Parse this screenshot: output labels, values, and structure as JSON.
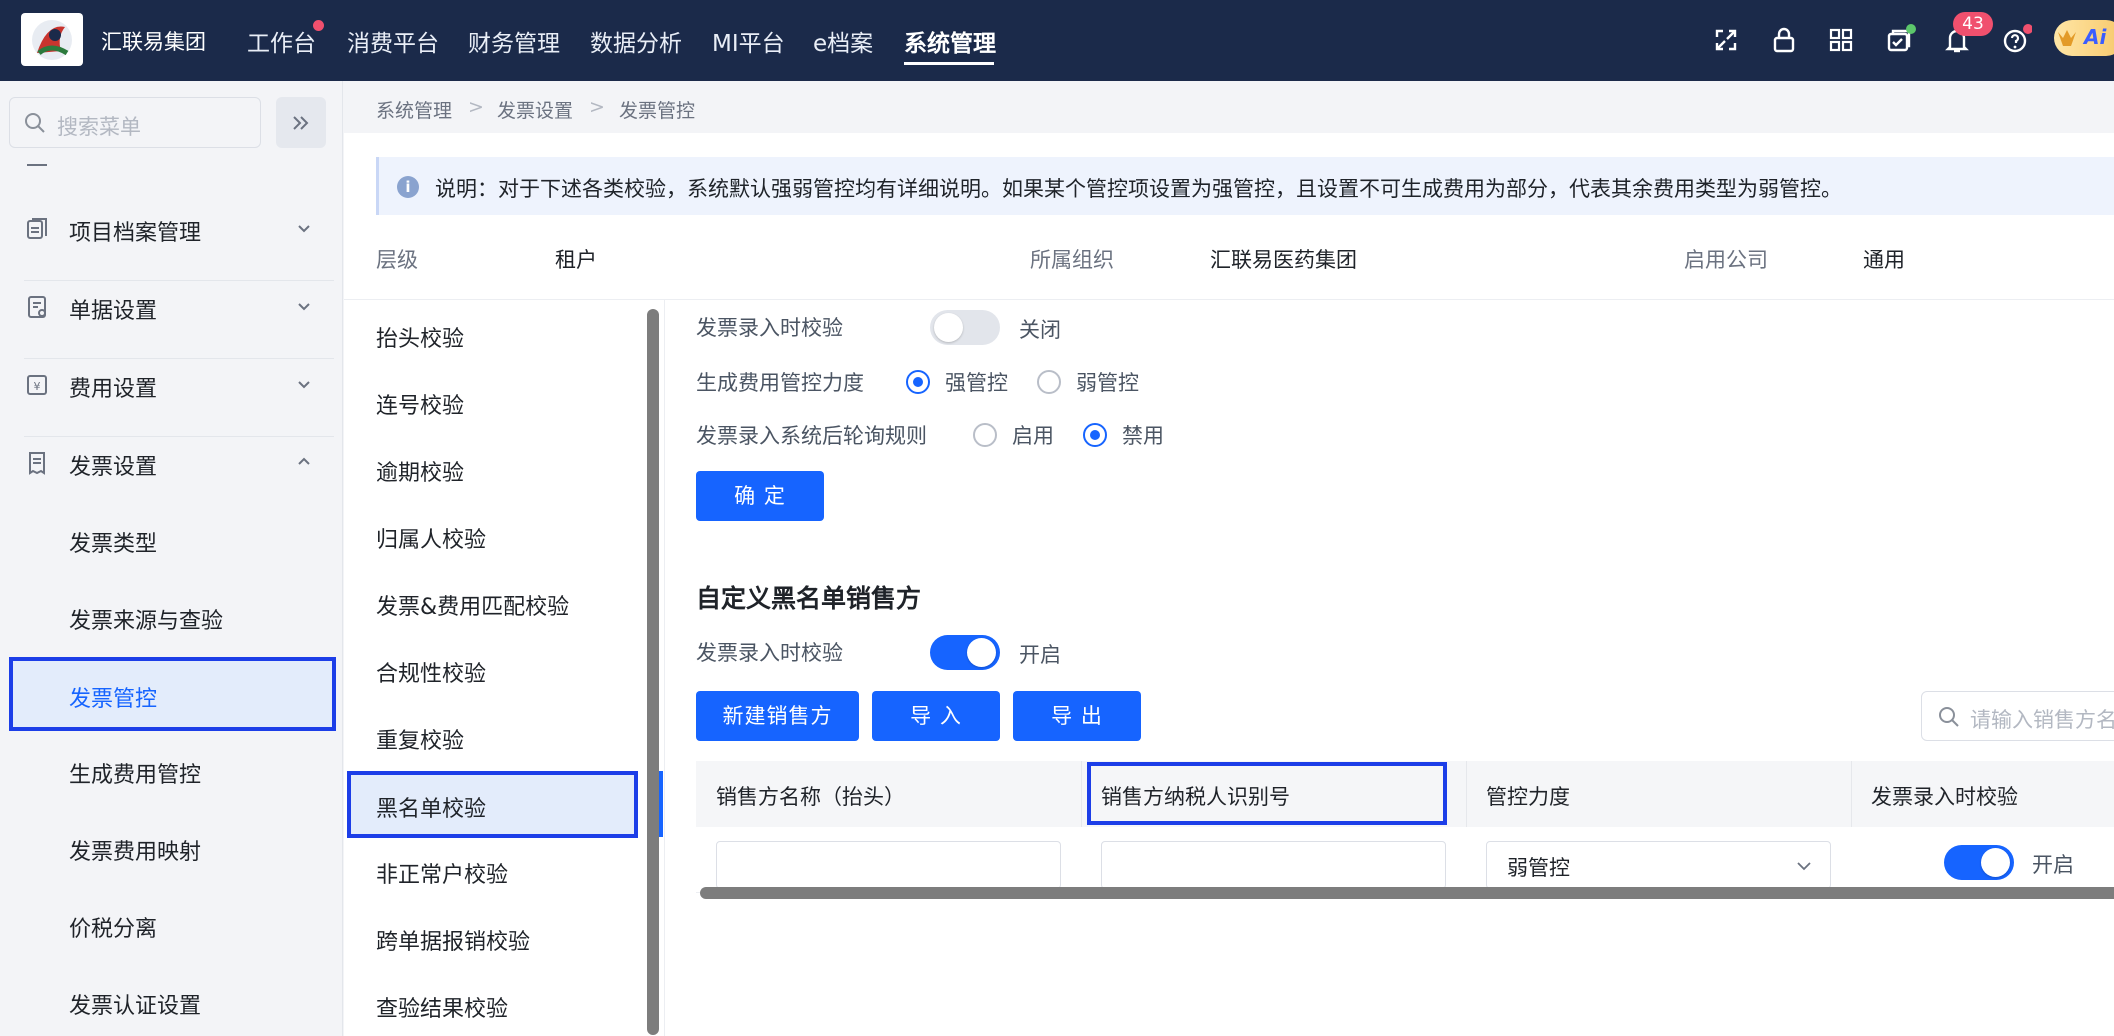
{
  "topbar": {
    "brand": "汇联易集团",
    "nav": [
      "工作台",
      "消费平台",
      "财务管理",
      "数据分析",
      "MI平台",
      "e档案",
      "系统管理"
    ],
    "active_nav": "系统管理",
    "notification_count": "43",
    "ai_label": "Ai"
  },
  "leftmenu": {
    "search_placeholder": "搜索菜单",
    "groups": [
      {
        "label": "项目档案管理",
        "icon": "project-file-icon"
      },
      {
        "label": "单据设置",
        "icon": "document-settings-icon"
      },
      {
        "label": "费用设置",
        "icon": "expense-icon"
      },
      {
        "label": "发票设置",
        "icon": "invoice-icon"
      }
    ],
    "sub_items": [
      "发票类型",
      "发票来源与查验",
      "发票管控",
      "生成费用管控",
      "发票费用映射",
      "价税分离",
      "发票认证设置"
    ],
    "active_sub": "发票管控"
  },
  "breadcrumb": [
    "系统管理",
    "发票设置",
    "发票管控"
  ],
  "notice": "说明：对于下述各类校验，系统默认强弱管控均有详细说明。如果某个管控项设置为强管控，且设置不可生成费用为部分，代表其余费用类型为弱管控。",
  "meta": {
    "level_label": "层级",
    "level_value": "租户",
    "org_label": "所属组织",
    "org_value": "汇联易医药集团",
    "company_label": "启用公司",
    "company_value": "通用"
  },
  "subnav": {
    "items": [
      "抬头校验",
      "连号校验",
      "逾期校验",
      "归属人校验",
      "发票&费用匹配校验",
      "合规性校验",
      "重复校验",
      "黑名单校验",
      "非正常户校验",
      "跨单据报销校验",
      "查验结果校验"
    ],
    "active": "黑名单校验"
  },
  "settings": {
    "entry_check_label": "发票录入时校验",
    "entry_check_state": "关闭",
    "control_label": "生成费用管控力度",
    "control_options": [
      "强管控",
      "弱管控"
    ],
    "control_selected": "强管控",
    "poll_label": "发票录入系统后轮询规则",
    "poll_options": [
      "启用",
      "禁用"
    ],
    "poll_selected": "禁用",
    "confirm_button": "确 定"
  },
  "blacklist": {
    "title": "自定义黑名单销售方",
    "entry_check_label": "发票录入时校验",
    "entry_check_state": "开启",
    "buttons": {
      "new": "新建销售方",
      "import": "导 入",
      "export": "导 出"
    },
    "search_placeholder": "请输入销售方名称",
    "columns": [
      "销售方名称（抬头）",
      "销售方纳税人识别号",
      "管控力度",
      "发票录入时校验"
    ],
    "rows": [
      {
        "name": "",
        "tax_id": "",
        "control": "弱管控",
        "entry_check": "开启"
      }
    ]
  }
}
